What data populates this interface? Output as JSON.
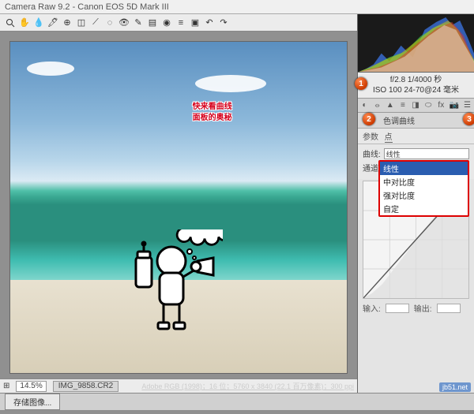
{
  "window": {
    "title": "Camera Raw 9.2  -  Canon EOS 5D Mark III"
  },
  "toolbar_icons": [
    "zoom-icon",
    "hand-icon",
    "eyedropper-white-icon",
    "eyedropper-color-icon",
    "target-icon",
    "crop-icon",
    "straighten-icon",
    "spot-icon",
    "redeye-icon",
    "adjust-brush-icon",
    "gradient-icon",
    "radial-icon",
    "preset-icon",
    "snapshot-icon",
    "open-icon",
    "rotate-ccw-icon",
    "rotate-cw-icon"
  ],
  "canvas": {
    "overlay_line1": "快来看曲线",
    "overlay_line2": "面板的奥秘"
  },
  "bottom": {
    "zoom": "14.5%",
    "filename": "IMG_9858.CR2",
    "metadata": "Adobe RGB (1998)；16 位；5760 x 3840 (22.1 百万像素)；300 ppi"
  },
  "meta": {
    "line1": "f/2.8  1/4000 秒",
    "line2": "ISO 100  24-70@24 毫米"
  },
  "markers": {
    "m1": "1",
    "m2": "2",
    "m3": "3"
  },
  "panel": {
    "header": "色调曲线",
    "tab_params": "参数",
    "tab_point": "点",
    "curve_label": "曲线:",
    "curve_value": "线性",
    "channel_label": "通道:",
    "options": {
      "o1": "线性",
      "o2": "中对比度",
      "o3": "强对比度",
      "o4": "自定"
    },
    "input_label": "输入:",
    "output_label": "输出:"
  },
  "footer": {
    "save": "存储图像..."
  },
  "watermark": "jb51.net"
}
